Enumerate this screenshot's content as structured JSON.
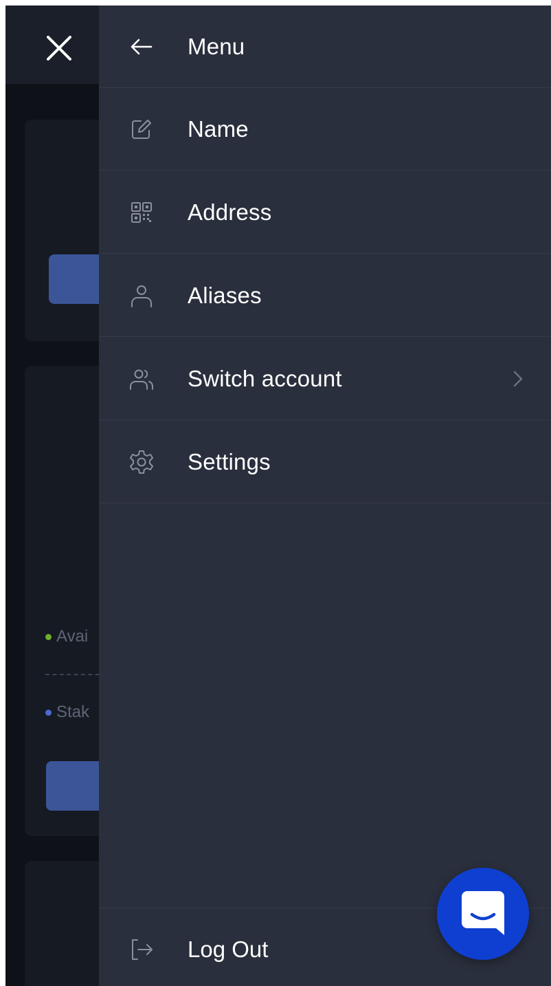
{
  "background": {
    "legend": [
      {
        "text": "Avai",
        "color": "#6fae2e"
      },
      {
        "text": "Stak",
        "color": "#4a6ad0"
      }
    ]
  },
  "close_icon": "close-icon",
  "drawer": {
    "title": "Menu",
    "back_icon": "arrow-left-icon",
    "items": [
      {
        "label": "Name",
        "icon": "edit-icon"
      },
      {
        "label": "Address",
        "icon": "qr-code-icon"
      },
      {
        "label": "Aliases",
        "icon": "user-icon"
      },
      {
        "label": "Switch account",
        "icon": "users-icon",
        "has_submenu": true
      },
      {
        "label": "Settings",
        "icon": "gear-icon"
      }
    ],
    "logout": {
      "label": "Log Out",
      "icon": "logout-icon"
    }
  },
  "chat": {
    "icon": "chat-bubble-icon",
    "color": "#0f3fd0"
  },
  "colors": {
    "drawer_bg": "#2a2f3d",
    "app_bg": "#0e1118",
    "accent_button": "#3b5598",
    "icon_gray": "#8a90a0",
    "text": "#ffffff"
  }
}
